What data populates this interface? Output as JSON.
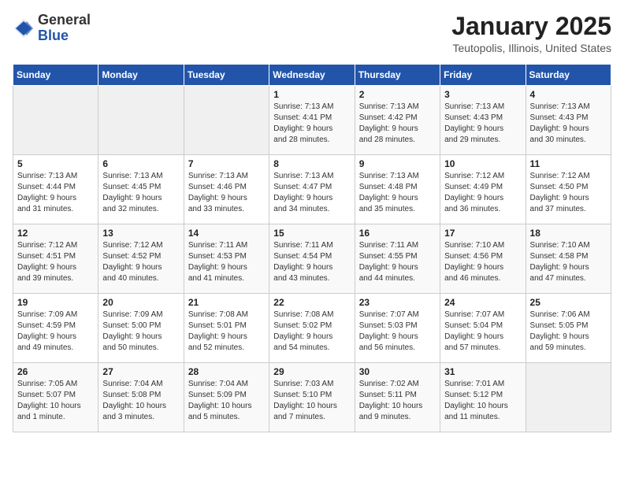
{
  "header": {
    "logo_line1": "General",
    "logo_line2": "Blue",
    "title": "January 2025",
    "subtitle": "Teutopolis, Illinois, United States"
  },
  "weekdays": [
    "Sunday",
    "Monday",
    "Tuesday",
    "Wednesday",
    "Thursday",
    "Friday",
    "Saturday"
  ],
  "weeks": [
    [
      {
        "day": "",
        "detail": ""
      },
      {
        "day": "",
        "detail": ""
      },
      {
        "day": "",
        "detail": ""
      },
      {
        "day": "1",
        "detail": "Sunrise: 7:13 AM\nSunset: 4:41 PM\nDaylight: 9 hours\nand 28 minutes."
      },
      {
        "day": "2",
        "detail": "Sunrise: 7:13 AM\nSunset: 4:42 PM\nDaylight: 9 hours\nand 28 minutes."
      },
      {
        "day": "3",
        "detail": "Sunrise: 7:13 AM\nSunset: 4:43 PM\nDaylight: 9 hours\nand 29 minutes."
      },
      {
        "day": "4",
        "detail": "Sunrise: 7:13 AM\nSunset: 4:43 PM\nDaylight: 9 hours\nand 30 minutes."
      }
    ],
    [
      {
        "day": "5",
        "detail": "Sunrise: 7:13 AM\nSunset: 4:44 PM\nDaylight: 9 hours\nand 31 minutes."
      },
      {
        "day": "6",
        "detail": "Sunrise: 7:13 AM\nSunset: 4:45 PM\nDaylight: 9 hours\nand 32 minutes."
      },
      {
        "day": "7",
        "detail": "Sunrise: 7:13 AM\nSunset: 4:46 PM\nDaylight: 9 hours\nand 33 minutes."
      },
      {
        "day": "8",
        "detail": "Sunrise: 7:13 AM\nSunset: 4:47 PM\nDaylight: 9 hours\nand 34 minutes."
      },
      {
        "day": "9",
        "detail": "Sunrise: 7:13 AM\nSunset: 4:48 PM\nDaylight: 9 hours\nand 35 minutes."
      },
      {
        "day": "10",
        "detail": "Sunrise: 7:12 AM\nSunset: 4:49 PM\nDaylight: 9 hours\nand 36 minutes."
      },
      {
        "day": "11",
        "detail": "Sunrise: 7:12 AM\nSunset: 4:50 PM\nDaylight: 9 hours\nand 37 minutes."
      }
    ],
    [
      {
        "day": "12",
        "detail": "Sunrise: 7:12 AM\nSunset: 4:51 PM\nDaylight: 9 hours\nand 39 minutes."
      },
      {
        "day": "13",
        "detail": "Sunrise: 7:12 AM\nSunset: 4:52 PM\nDaylight: 9 hours\nand 40 minutes."
      },
      {
        "day": "14",
        "detail": "Sunrise: 7:11 AM\nSunset: 4:53 PM\nDaylight: 9 hours\nand 41 minutes."
      },
      {
        "day": "15",
        "detail": "Sunrise: 7:11 AM\nSunset: 4:54 PM\nDaylight: 9 hours\nand 43 minutes."
      },
      {
        "day": "16",
        "detail": "Sunrise: 7:11 AM\nSunset: 4:55 PM\nDaylight: 9 hours\nand 44 minutes."
      },
      {
        "day": "17",
        "detail": "Sunrise: 7:10 AM\nSunset: 4:56 PM\nDaylight: 9 hours\nand 46 minutes."
      },
      {
        "day": "18",
        "detail": "Sunrise: 7:10 AM\nSunset: 4:58 PM\nDaylight: 9 hours\nand 47 minutes."
      }
    ],
    [
      {
        "day": "19",
        "detail": "Sunrise: 7:09 AM\nSunset: 4:59 PM\nDaylight: 9 hours\nand 49 minutes."
      },
      {
        "day": "20",
        "detail": "Sunrise: 7:09 AM\nSunset: 5:00 PM\nDaylight: 9 hours\nand 50 minutes."
      },
      {
        "day": "21",
        "detail": "Sunrise: 7:08 AM\nSunset: 5:01 PM\nDaylight: 9 hours\nand 52 minutes."
      },
      {
        "day": "22",
        "detail": "Sunrise: 7:08 AM\nSunset: 5:02 PM\nDaylight: 9 hours\nand 54 minutes."
      },
      {
        "day": "23",
        "detail": "Sunrise: 7:07 AM\nSunset: 5:03 PM\nDaylight: 9 hours\nand 56 minutes."
      },
      {
        "day": "24",
        "detail": "Sunrise: 7:07 AM\nSunset: 5:04 PM\nDaylight: 9 hours\nand 57 minutes."
      },
      {
        "day": "25",
        "detail": "Sunrise: 7:06 AM\nSunset: 5:05 PM\nDaylight: 9 hours\nand 59 minutes."
      }
    ],
    [
      {
        "day": "26",
        "detail": "Sunrise: 7:05 AM\nSunset: 5:07 PM\nDaylight: 10 hours\nand 1 minute."
      },
      {
        "day": "27",
        "detail": "Sunrise: 7:04 AM\nSunset: 5:08 PM\nDaylight: 10 hours\nand 3 minutes."
      },
      {
        "day": "28",
        "detail": "Sunrise: 7:04 AM\nSunset: 5:09 PM\nDaylight: 10 hours\nand 5 minutes."
      },
      {
        "day": "29",
        "detail": "Sunrise: 7:03 AM\nSunset: 5:10 PM\nDaylight: 10 hours\nand 7 minutes."
      },
      {
        "day": "30",
        "detail": "Sunrise: 7:02 AM\nSunset: 5:11 PM\nDaylight: 10 hours\nand 9 minutes."
      },
      {
        "day": "31",
        "detail": "Sunrise: 7:01 AM\nSunset: 5:12 PM\nDaylight: 10 hours\nand 11 minutes."
      },
      {
        "day": "",
        "detail": ""
      }
    ]
  ]
}
